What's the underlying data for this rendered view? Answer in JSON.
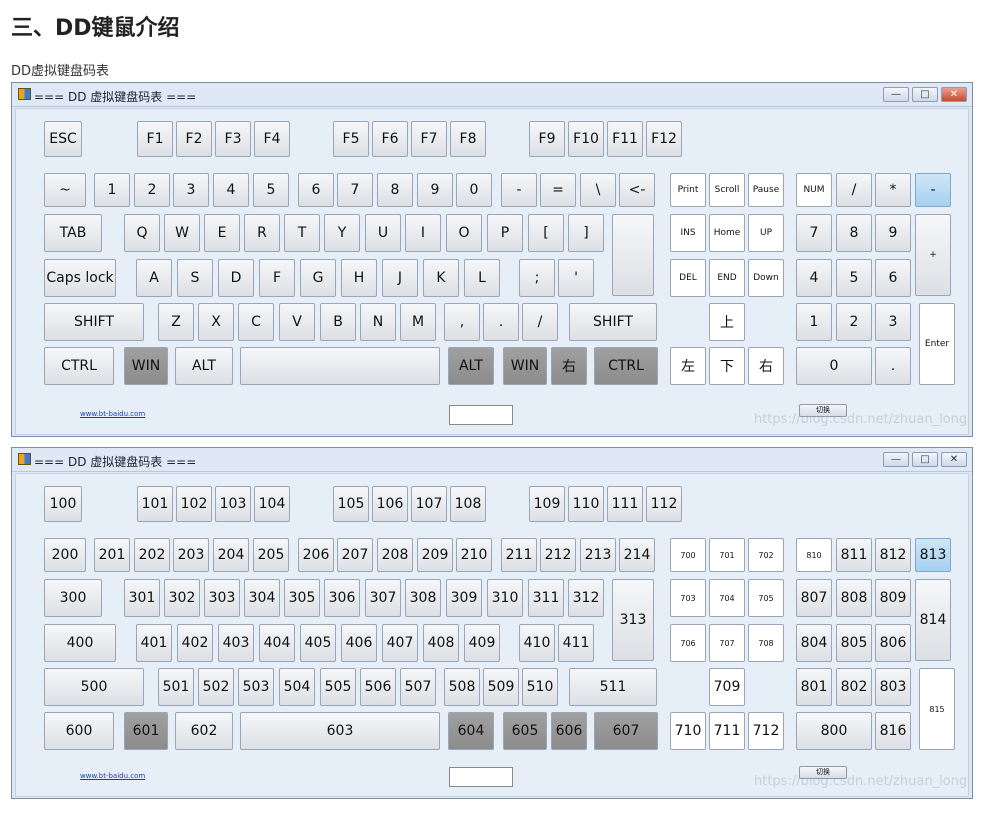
{
  "heading": "三、DD键鼠介绍",
  "caption": "DD虚拟键盘码表",
  "windows": [
    {
      "title": "=== DD 虚拟键盘码表 ===",
      "close_style": "red",
      "footer": {
        "link": "www.bt-baidu.com",
        "button": "切换",
        "watermark": "https://blog.csdn.net/zhuan_long"
      },
      "keys": [
        [
          "ESC",
          "F1",
          "F2",
          "F3",
          "F4",
          "F5",
          "F6",
          "F7",
          "F8",
          "F9",
          "F10",
          "F11",
          "F12"
        ],
        [
          "~",
          "1",
          "2",
          "3",
          "4",
          "5",
          "6",
          "7",
          "8",
          "9",
          "0",
          "-",
          "=",
          "\\",
          "<-",
          "Print",
          "Scroll",
          "Pause",
          "NUM",
          "/",
          "*",
          "-"
        ],
        [
          "TAB",
          "Q",
          "W",
          "E",
          "R",
          "T",
          "Y",
          "U",
          "I",
          "O",
          "P",
          "[",
          "]",
          "",
          "INS",
          "Home",
          "UP",
          "7",
          "8",
          "9",
          "+"
        ],
        [
          "Caps lock",
          "A",
          "S",
          "D",
          "F",
          "G",
          "H",
          "J",
          "K",
          "L",
          ";",
          "'",
          "DEL",
          "END",
          "Down",
          "4",
          "5",
          "6"
        ],
        [
          "SHIFT",
          "Z",
          "X",
          "C",
          "V",
          "B",
          "N",
          "M",
          ",",
          ".",
          "/",
          "SHIFT",
          "上",
          "1",
          "2",
          "3",
          "Enter"
        ],
        [
          "CTRL",
          "WIN",
          "ALT",
          "",
          "ALT",
          "WIN",
          "右",
          "CTRL",
          "左",
          "下",
          "右",
          "0",
          "."
        ]
      ]
    },
    {
      "title": "=== DD 虚拟键盘码表 ===",
      "close_style": "plain",
      "footer": {
        "link": "www.bt-baidu.com",
        "button": "切换",
        "watermark": "https://blog.csdn.net/zhuan_long"
      },
      "keys": [
        [
          "100",
          "101",
          "102",
          "103",
          "104",
          "105",
          "106",
          "107",
          "108",
          "109",
          "110",
          "111",
          "112"
        ],
        [
          "200",
          "201",
          "202",
          "203",
          "204",
          "205",
          "206",
          "207",
          "208",
          "209",
          "210",
          "211",
          "212",
          "213",
          "214",
          "700",
          "701",
          "702",
          "810",
          "811",
          "812",
          "813"
        ],
        [
          "300",
          "301",
          "302",
          "303",
          "304",
          "305",
          "306",
          "307",
          "308",
          "309",
          "310",
          "311",
          "312",
          "313",
          "703",
          "704",
          "705",
          "807",
          "808",
          "809",
          "814"
        ],
        [
          "400",
          "401",
          "402",
          "403",
          "404",
          "405",
          "406",
          "407",
          "408",
          "409",
          "410",
          "411",
          "706",
          "707",
          "708",
          "804",
          "805",
          "806"
        ],
        [
          "500",
          "501",
          "502",
          "503",
          "504",
          "505",
          "506",
          "507",
          "508",
          "509",
          "510",
          "511",
          "709",
          "801",
          "802",
          "803",
          "815"
        ],
        [
          "600",
          "601",
          "602",
          "603",
          "604",
          "605",
          "606",
          "607",
          "710",
          "711",
          "712",
          "800",
          "816"
        ]
      ]
    }
  ]
}
